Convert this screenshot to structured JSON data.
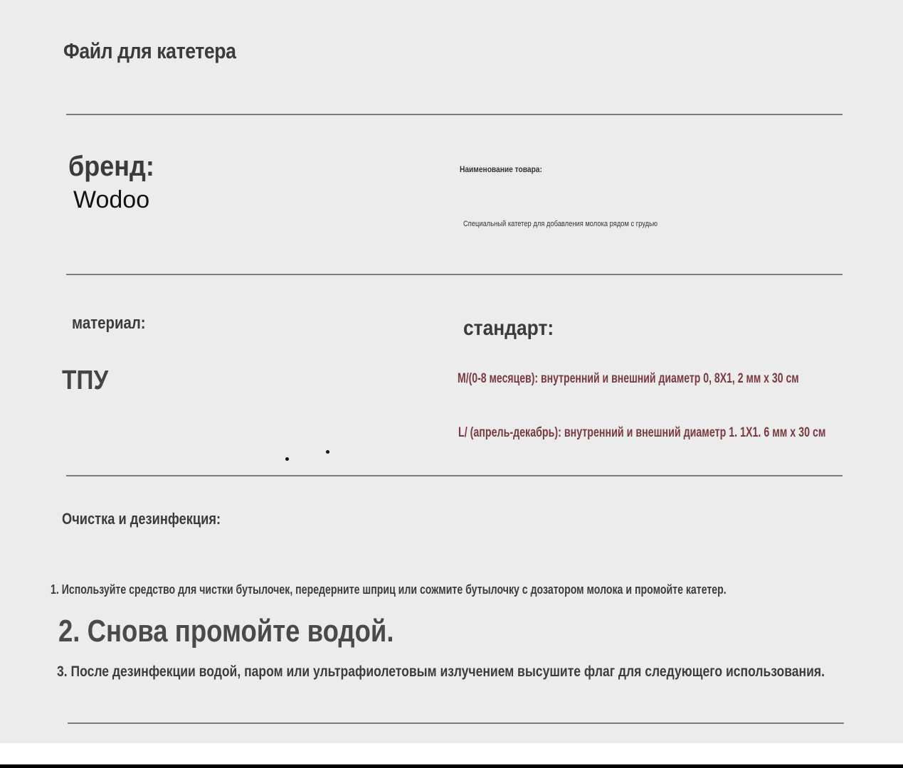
{
  "header": {
    "title": "Файл для катетера"
  },
  "brand": {
    "label": "бренд:",
    "value": "Wodoo"
  },
  "product": {
    "label": "Наименование товара:",
    "value": "Специальный катетер для добавления молока рядом с грудью"
  },
  "material": {
    "label": "материал:",
    "value": "ТПУ"
  },
  "standard": {
    "label": "стандарт:",
    "size_m": "M/(0-8 месяцев): внутренний и внешний диаметр 0, 8X1, 2 мм x 30 см",
    "size_l": "L/ (апрель-декабрь): внутренний и внешний диаметр 1. 1X1. 6 мм x 30 см",
    "text_color": "#7a3a42"
  },
  "cleaning": {
    "label": "Очистка и дезинфекция:",
    "steps": [
      "1. Используйте средство для чистки бутылочек, передерните шприц или сожмите бутылочку с дозатором молока и промойте катетер.",
      "2. Снова промойте водой.",
      "3. После дезинфекции водой, паром или ультрафиолетовым излучением высушите флаг для следующего использования."
    ]
  },
  "colors": {
    "page_background": "#ececec",
    "text": "#3b3b3b",
    "divider": "#6a6a6a"
  }
}
